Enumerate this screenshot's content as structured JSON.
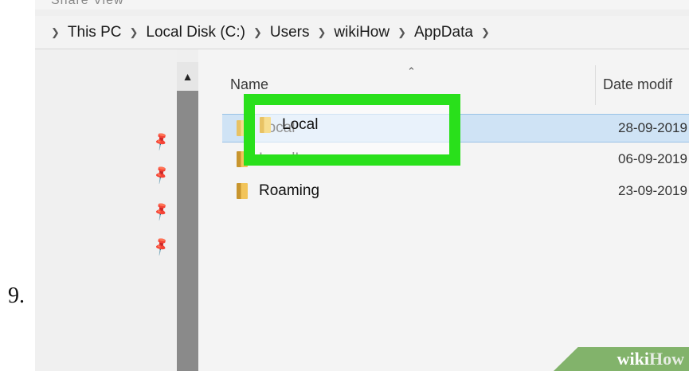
{
  "step": {
    "number": "9."
  },
  "ribbon": {
    "text": "Share     View"
  },
  "breadcrumb": [
    {
      "label": "This PC"
    },
    {
      "label": "Local Disk (C:)"
    },
    {
      "label": "Users"
    },
    {
      "label": "wikiHow"
    },
    {
      "label": "AppData"
    }
  ],
  "columns": {
    "name": "Name",
    "date": "Date modif"
  },
  "files": [
    {
      "name": "Local",
      "date": "28-09-2019",
      "selected": true
    },
    {
      "name": "LocalLow",
      "date": "06-09-2019",
      "selected": false
    },
    {
      "name": "Roaming",
      "date": "23-09-2019",
      "selected": false
    }
  ],
  "watermark": {
    "part1": "wiki",
    "part2": "How"
  },
  "colors": {
    "highlight": "#29e01b",
    "selection": "#cfe3f5",
    "folder": "#f2c45a"
  }
}
